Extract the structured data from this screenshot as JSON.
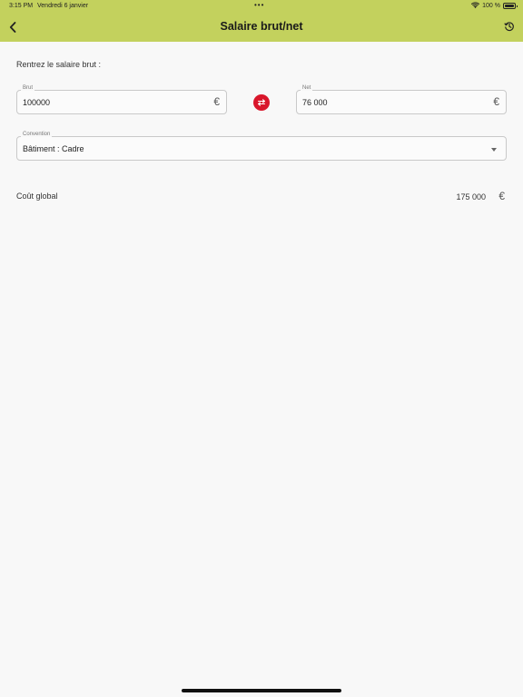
{
  "status_bar": {
    "time": "3:15 PM",
    "date": "Vendredi 6 janvier",
    "dots": "•••",
    "battery": "100 %"
  },
  "header": {
    "title": "Salaire brut/net",
    "back_icon": "chevron-left-icon",
    "history_icon": "history-icon"
  },
  "form": {
    "prompt": "Rentrez le salaire brut :",
    "gross": {
      "label": "Brut",
      "value": "100000",
      "currency": "€"
    },
    "net": {
      "label": "Net",
      "value": "76 000",
      "currency": "€"
    },
    "swap_icon": "swap-icon",
    "convention": {
      "label": "Convention",
      "value": "Bâtiment : Cadre"
    }
  },
  "result": {
    "label": "Coût global",
    "value": "175 000",
    "currency": "€"
  },
  "colors": {
    "header_bg": "#c3d15d",
    "swap_button": "#d9162b",
    "background": "#f8f8f8"
  }
}
